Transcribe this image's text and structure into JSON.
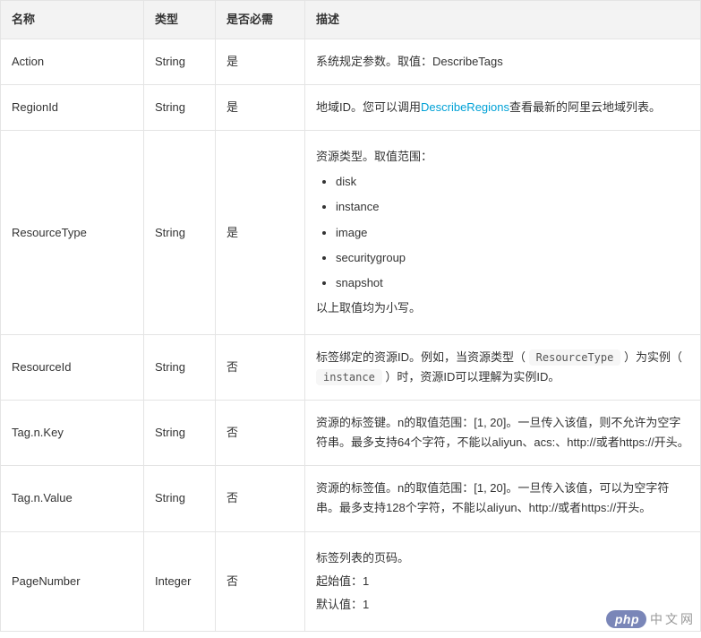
{
  "headers": {
    "name": "名称",
    "type": "类型",
    "required": "是否必需",
    "description": "描述"
  },
  "rows": {
    "action": {
      "name": "Action",
      "type": "String",
      "required": "是",
      "desc_text": "系统规定参数。取值：DescribeTags"
    },
    "regionId": {
      "name": "RegionId",
      "type": "String",
      "required": "是",
      "desc_prefix": "地域ID。您可以调用",
      "desc_link": "DescribeRegions",
      "desc_suffix": "查看最新的阿里云地域列表。"
    },
    "resourceType": {
      "name": "ResourceType",
      "type": "String",
      "required": "是",
      "desc_title": "资源类型。取值范围：",
      "values": [
        "disk",
        "instance",
        "image",
        "securitygroup",
        "snapshot"
      ],
      "desc_tail": "以上取值均为小写。"
    },
    "resourceId": {
      "name": "ResourceId",
      "type": "String",
      "required": "否",
      "p1a": "标签绑定的资源ID。例如，当资源类型（",
      "code1": "ResourceType",
      "p1b": "）为实例（",
      "code2": "instance",
      "p1c": "）时，资源ID可以理解为实例ID。"
    },
    "tagKey": {
      "name": "Tag.n.Key",
      "type": "String",
      "required": "否",
      "desc_text": "资源的标签键。n的取值范围：[1, 20]。一旦传入该值，则不允许为空字符串。最多支持64个字符，不能以aliyun、acs:、http://或者https://开头。"
    },
    "tagValue": {
      "name": "Tag.n.Value",
      "type": "String",
      "required": "否",
      "desc_text": "资源的标签值。n的取值范围：[1, 20]。一旦传入该值，可以为空字符串。最多支持128个字符，不能以aliyun、http://或者https://开头。"
    },
    "pageNumber": {
      "name": "PageNumber",
      "type": "Integer",
      "required": "否",
      "line1": "标签列表的页码。",
      "line2": "起始值：1",
      "line3": "默认值：1"
    }
  },
  "badge": {
    "php": "php",
    "site": "中文网"
  }
}
